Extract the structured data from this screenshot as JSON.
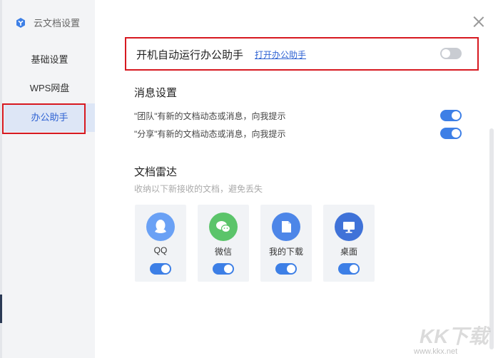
{
  "window": {
    "title": "云文档设置"
  },
  "sidebar": {
    "items": [
      {
        "label": "基础设置"
      },
      {
        "label": "WPS网盘"
      },
      {
        "label": "办公助手",
        "active": true
      }
    ]
  },
  "autostart": {
    "label": "开机自动运行办公助手",
    "link": "打开办公助手",
    "enabled": false
  },
  "messages": {
    "title": "消息设置",
    "items": [
      {
        "label": "\"团队\"有新的文档动态或消息，向我提示",
        "enabled": true
      },
      {
        "label": "\"分享\"有新的文档动态或消息，向我提示",
        "enabled": true
      }
    ]
  },
  "radar": {
    "title": "文档雷达",
    "description": "收纳以下新接收的文档，避免丢失",
    "sources": [
      {
        "label": "QQ",
        "icon": "qq-icon",
        "color": "#6aa1f5",
        "enabled": true
      },
      {
        "label": "微信",
        "icon": "wechat-icon",
        "color": "#5bc46a",
        "enabled": true
      },
      {
        "label": "我的下载",
        "icon": "download-file-icon",
        "color": "#4d86e8",
        "enabled": true
      },
      {
        "label": "桌面",
        "icon": "desktop-icon",
        "color": "#3f72d8",
        "enabled": true
      }
    ]
  },
  "watermark": {
    "brand": "KK下载",
    "url": "www.kkx.net"
  },
  "colors": {
    "accent": "#3d7fe6",
    "highlight": "#d71920",
    "toggle_off": "#c9ccd2"
  }
}
